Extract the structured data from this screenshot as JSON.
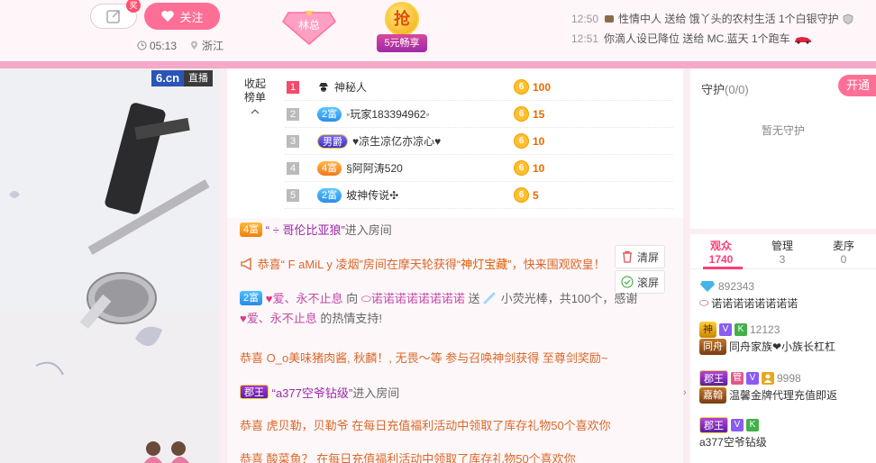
{
  "header": {
    "share_badge": "奖",
    "follow_label": "关注",
    "time": "05:13",
    "location": "浙江",
    "badge_linzong": "林总",
    "badge_qiang": "抢",
    "badge_qiang_sub": "5元畅享",
    "notices": [
      {
        "time": "12:50",
        "text": "性情中人 送给 饿丫头的农村生活 1个白银守护"
      },
      {
        "time": "12:51",
        "text": "你滴人设已降位 送给 MC.蓝天 1个跑车"
      }
    ]
  },
  "video": {
    "logo": "6.cn",
    "status": "直播"
  },
  "rank": {
    "collapse_label_1": "收起",
    "collapse_label_2": "榜单",
    "rows": [
      {
        "num": "1",
        "badge": "",
        "name": "神秘人",
        "amount": "100"
      },
      {
        "num": "2",
        "badge": "2富",
        "name": "◦玩家183394962◦",
        "amount": "15"
      },
      {
        "num": "3",
        "badge": "男爵",
        "name": "♥凉生凉亿亦凉心♥",
        "amount": "10"
      },
      {
        "num": "4",
        "badge": "4富",
        "name": "§阿阿涛520",
        "amount": "10"
      },
      {
        "num": "5",
        "badge": "2富",
        "name": "坡神传说✣",
        "amount": "5"
      }
    ],
    "coin_glyph": "6"
  },
  "chat": {
    "clear_label": "清屏",
    "scroll_label": "滚屏",
    "messages": [
      {
        "badge": "4富",
        "user": "“ ÷ 哥伦比亚狼”",
        "text": "进入房间"
      },
      {
        "prefix": "恭喜“ F aMiL y 凌烟”",
        "text": "房间在摩天轮获得“",
        "item": "神灯宝藏",
        "suffix": "”，快来围观欧皇！"
      },
      {
        "badge": "2富",
        "user": "爱、永不止息",
        "mid": " 向 ",
        "target": "诺诺诺诺诺诺诺诺",
        "gift": " 送 ",
        "gift_tail": " 小荧光棒，共100个，感谢",
        "thanks_user": "爱、永不止息",
        "thanks_tail": " 的热情支持!"
      },
      {
        "text": "恭喜 O_o美味猪肉酱, 秋麟！, 无畏～等 参与召唤神剑获得 至尊剑奖励~"
      },
      {
        "badge": "郡王",
        "user": "“a377空爷钻级”",
        "text": "进入房间"
      },
      {
        "text": "恭喜 虎贝勒，贝勒爷 在每日充值福利活动中领取了库存礼物50个喜欢你"
      },
      {
        "text": "恭喜 酸菜鱼？ 在每日充值福利活动中领取了库存礼物50个喜欢你"
      }
    ]
  },
  "guard": {
    "title": "守护",
    "count": "(0/0)",
    "open_label": "开通",
    "empty_text": "暂无守护"
  },
  "audience": {
    "tabs": [
      {
        "label": "观众",
        "count": "1740"
      },
      {
        "label": "管理",
        "count": "3"
      },
      {
        "label": "麦序",
        "count": "0"
      }
    ],
    "users": [
      {
        "id": "892343",
        "name": "诺诺诺诺诺诺诺诺"
      },
      {
        "badge": "神",
        "id": "12123",
        "family": "同舟",
        "name": "同舟家族❤小族长杠杠"
      },
      {
        "badge": "郡王",
        "id": "9998",
        "family": "嘉翰",
        "name": "温馨金牌代理充值即返"
      },
      {
        "badge": "郡王",
        "name": "a377空爷钻级"
      }
    ],
    "vk_v": "V",
    "vk_k": "K",
    "vk_g": "管"
  }
}
